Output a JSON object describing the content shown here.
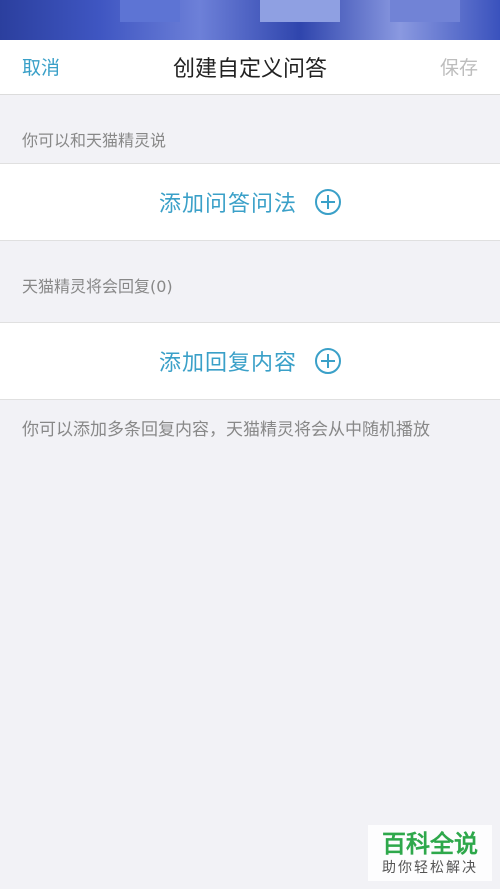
{
  "nav": {
    "cancel": "取消",
    "title": "创建自定义问答",
    "save": "保存"
  },
  "section1": {
    "label": "你可以和天猫精灵说",
    "action": "添加问答问法",
    "icon": "plus-circle-icon"
  },
  "section2": {
    "label": "天猫精灵将会回复(0)",
    "action": "添加回复内容",
    "icon": "plus-circle-icon"
  },
  "hint": "你可以添加多条回复内容，天猫精灵将会从中随机播放",
  "watermark": {
    "main": "百科全说",
    "sub": "助你轻松解决"
  },
  "colors": {
    "accent": "#3aa0c8",
    "muted": "#888888",
    "disabled": "#bdbdbd"
  }
}
